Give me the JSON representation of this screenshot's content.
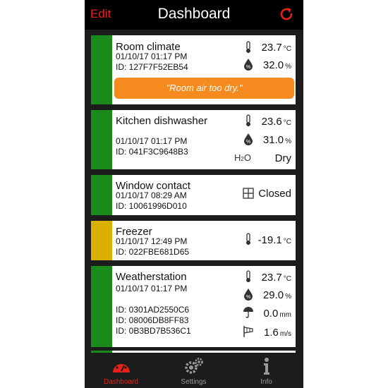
{
  "header": {
    "edit_label": "Edit",
    "title": "Dashboard",
    "refresh_icon": "refresh-icon"
  },
  "colors": {
    "accent": "#e8221b",
    "status_ok": "#1a8a1a",
    "status_warn": "#d9b000",
    "bubble": "#f58a1f"
  },
  "devices": [
    {
      "name": "Room climate",
      "datetime": "01/10/17  01:17 PM",
      "ids": [
        "ID: 127F7F52EB54"
      ],
      "status": "green",
      "readings": [
        {
          "icon": "thermometer-icon",
          "value": "23.7",
          "unit": "°C"
        },
        {
          "icon": "humidity-drop-icon",
          "value": "32.0",
          "unit": "%"
        }
      ],
      "alert": "\"Room air too dry.\""
    },
    {
      "name": "Kitchen dishwasher",
      "datetime": "01/10/17  01:17 PM",
      "ids": [
        "ID: 041F3C9648B3"
      ],
      "status": "green",
      "readings": [
        {
          "icon": "thermometer-icon",
          "value": "23.6",
          "unit": "°C"
        },
        {
          "icon": "humidity-drop-icon",
          "value": "31.0",
          "unit": "%"
        },
        {
          "icon": "water-h2o-icon",
          "value": "Dry",
          "unit": "",
          "icon_text": "H2O"
        }
      ]
    },
    {
      "name": "Window contact",
      "datetime": "01/10/17  08:29 AM",
      "ids": [
        "ID: 10061996D010"
      ],
      "status": "green",
      "readings": [
        {
          "icon": "window-icon",
          "value": "Closed",
          "unit": ""
        }
      ]
    },
    {
      "name": "Freezer",
      "datetime": "01/10/17  12:49 PM",
      "ids": [
        "ID: 022FBE681D65"
      ],
      "status": "yellow",
      "readings": [
        {
          "icon": "thermometer-icon",
          "value": "-19.1",
          "unit": "°C"
        }
      ]
    },
    {
      "name": "Weatherstation",
      "datetime": "01/10/17  01:17 PM",
      "ids": [
        "ID: 0301AD2550C6",
        "ID: 08006DB8FF83",
        "ID: 0B3BD7B536C1"
      ],
      "status": "green",
      "readings": [
        {
          "icon": "thermometer-icon",
          "value": "23.7",
          "unit": "°C"
        },
        {
          "icon": "humidity-drop-icon",
          "value": "29.0",
          "unit": "%"
        },
        {
          "icon": "umbrella-rain-icon",
          "value": "0.0",
          "unit": "mm"
        },
        {
          "icon": "windsock-icon",
          "value": "1.6",
          "unit": "m/s"
        }
      ]
    }
  ],
  "tabbar": {
    "items": [
      {
        "label": "Dashboard",
        "icon": "speedometer-icon",
        "active": true
      },
      {
        "label": "Settings",
        "icon": "gears-icon",
        "active": false
      },
      {
        "label": "Info",
        "icon": "info-icon",
        "active": false
      }
    ]
  }
}
